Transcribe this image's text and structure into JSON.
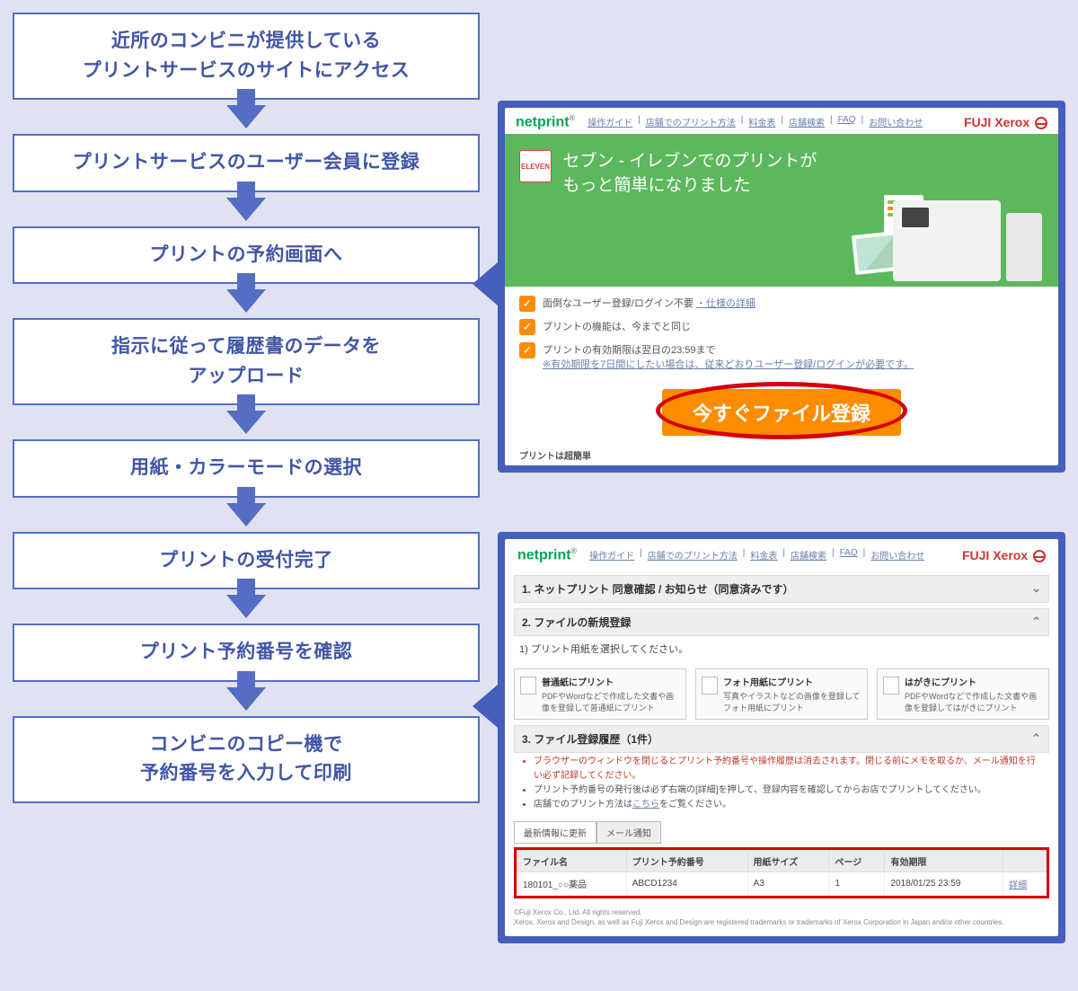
{
  "flow": {
    "steps": [
      "近所のコンビニが提供している\nプリントサービスのサイトにアクセス",
      "プリントサービスのユーザー会員に登録",
      "プリントの予約画面へ",
      "指示に従って履歴書のデータを\nアップロード",
      "用紙・カラーモードの選択",
      "プリントの受付完了",
      "プリント予約番号を確認",
      "コンビニのコピー機で\n予約番号を入力して印刷"
    ]
  },
  "panel1": {
    "brand": "netprint",
    "top_links": [
      "操作ガイド",
      "店舗でのプリント方法",
      "料金表",
      "店舗検索",
      "FAQ",
      "お問い合わせ"
    ],
    "fx": "FUJI Xerox",
    "seven_badge": "ELEVEN",
    "hero_line1": "セブン - イレブンでのプリントが",
    "hero_line2": "もっと簡単になりました",
    "features": [
      {
        "text": "面倒なユーザー登録/ログイン不要",
        "link": "・仕様の詳細"
      },
      {
        "text": "プリントの機能は、今までと同じ",
        "link": ""
      },
      {
        "text": "プリントの有効期限は翌日の23:59まで",
        "link": "※有効期限を7日間にしたい場合は、従来どおりユーザー登録/ログインが必要です。"
      }
    ],
    "cta": "今すぐファイル登録",
    "footer_snip": "プリントは超簡単"
  },
  "panel2": {
    "brand": "netprint",
    "top_links": [
      "操作ガイド",
      "店舗でのプリント方法",
      "料金表",
      "店舗検索",
      "FAQ",
      "お問い合わせ"
    ],
    "fx": "FUJI Xerox",
    "sec1": "1. ネットプリント 同意確認 / お知らせ（同意済みです）",
    "sec2": "2. ファイルの新規登録",
    "sec2_sub": "1) プリント用紙を選択してください。",
    "options": [
      {
        "title": "普通紙にプリント",
        "desc": "PDFやWordなどで作成した文書や画像を登録して普通紙にプリント"
      },
      {
        "title": "フォト用紙にプリント",
        "desc": "写真やイラストなどの画像を登録してフォト用紙にプリント"
      },
      {
        "title": "はがきにプリント",
        "desc": "PDFやWordなどで作成した文書や画像を登録してはがきにプリント"
      }
    ],
    "sec3": "3. ファイル登録履歴（1件）",
    "notes_red": "ブラウザーのウィンドウを閉じるとプリント予約番号や操作履歴は消去されます。閉じる前にメモを取るか、メール通知を行い必ず記録してください。",
    "notes_b1": "プリント予約番号の発行後は必ず右端の[詳細]を押して、登録内容を確認してからお店でプリントしてください。",
    "notes_b2_pre": "店舗でのプリント方法は",
    "notes_b2_link": "こちら",
    "notes_b2_post": "をご覧ください。",
    "tabs": [
      "最新情報に更新",
      "メール通知"
    ],
    "table": {
      "headers": [
        "ファイル名",
        "プリント予約番号",
        "用紙サイズ",
        "ページ",
        "有効期限",
        ""
      ],
      "row": [
        "180101_○○薬品",
        "ABCD1234",
        "A3",
        "1",
        "2018/01/25 23:59",
        "詳細"
      ]
    },
    "legal1": "©Fuji Xerox Co., Ltd. All rights reserved.",
    "legal2": "Xerox, Xerox and Design, as well as Fuji Xerox and Design are registered trademarks or trademarks of Xerox Corporation in Japan and/or other countries."
  }
}
